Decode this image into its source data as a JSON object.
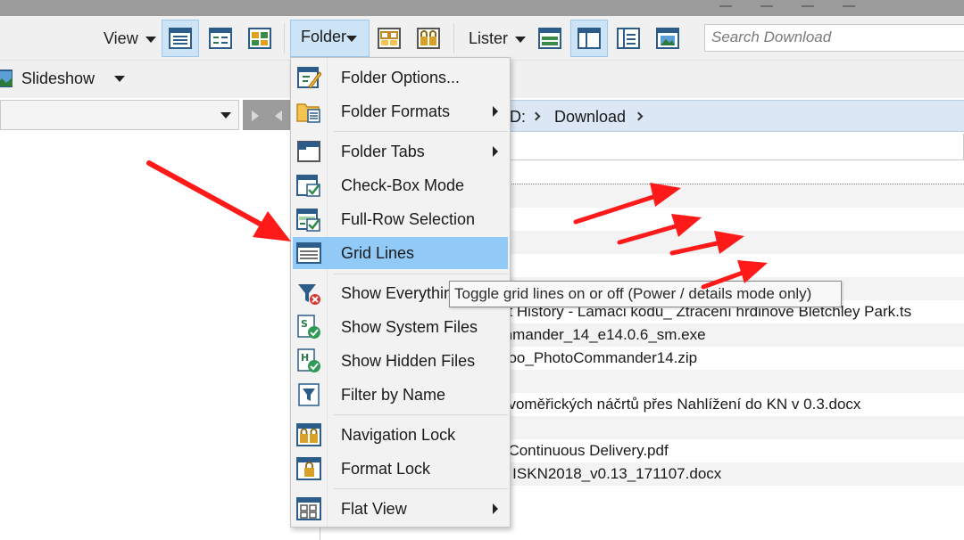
{
  "toolbar": {
    "view_label": "View",
    "folder_label": "Folder",
    "lister_label": "Lister",
    "search_placeholder": "Search Download"
  },
  "toolbar2": {
    "slideshow_label": "Slideshow"
  },
  "breadcrumb": {
    "drive": "D:",
    "folder": "Download"
  },
  "folder_menu": {
    "items": [
      {
        "label": "Folder Options...",
        "icon": "folder-options-icon",
        "submenu": false
      },
      {
        "label": "Folder Formats",
        "icon": "folder-formats-icon",
        "submenu": true
      },
      {
        "label": "Folder Tabs",
        "icon": "folder-tabs-icon",
        "submenu": true
      },
      {
        "label": "Check-Box Mode",
        "icon": "checkbox-mode-icon",
        "submenu": false
      },
      {
        "label": "Full-Row Selection",
        "icon": "full-row-selection-icon",
        "submenu": false
      },
      {
        "label": "Grid Lines",
        "icon": "grid-lines-icon",
        "submenu": false,
        "highlighted": true
      },
      {
        "label": "Show Everything",
        "icon": "show-everything-icon",
        "submenu": false
      },
      {
        "label": "Show System Files",
        "icon": "system-files-icon",
        "submenu": false
      },
      {
        "label": "Show Hidden Files",
        "icon": "hidden-files-icon",
        "submenu": false
      },
      {
        "label": "Filter by Name",
        "icon": "filter-icon",
        "submenu": false
      },
      {
        "label": "Navigation Lock",
        "icon": "navigation-lock-icon",
        "submenu": false
      },
      {
        "label": "Format Lock",
        "icon": "format-lock-icon",
        "submenu": false
      },
      {
        "label": "Flat View",
        "icon": "flat-view-icon",
        "submenu": true
      }
    ]
  },
  "tooltip": {
    "text": "Toggle grid lines on or off (Power / details mode only)"
  },
  "files": {
    "rows": [
      "at History - Lamači kódů_ Ztracení hrdinové Bletchley Park.ts",
      "mmander_14_e14.0.6_sm.exe",
      "ooo_PhotoCommander14.zip",
      "",
      "ovoměřických náčrtů přes Nahlížení do KN v 0.3.docx",
      "",
      "í Continuous Delivery.pdf",
      "e ISKN2018_v0.13_171107.docx"
    ]
  },
  "colors": {
    "accent_highlight": "#91c9f7",
    "active_button": "#cde4f7",
    "annotation_arrow": "#ff1a1a"
  }
}
